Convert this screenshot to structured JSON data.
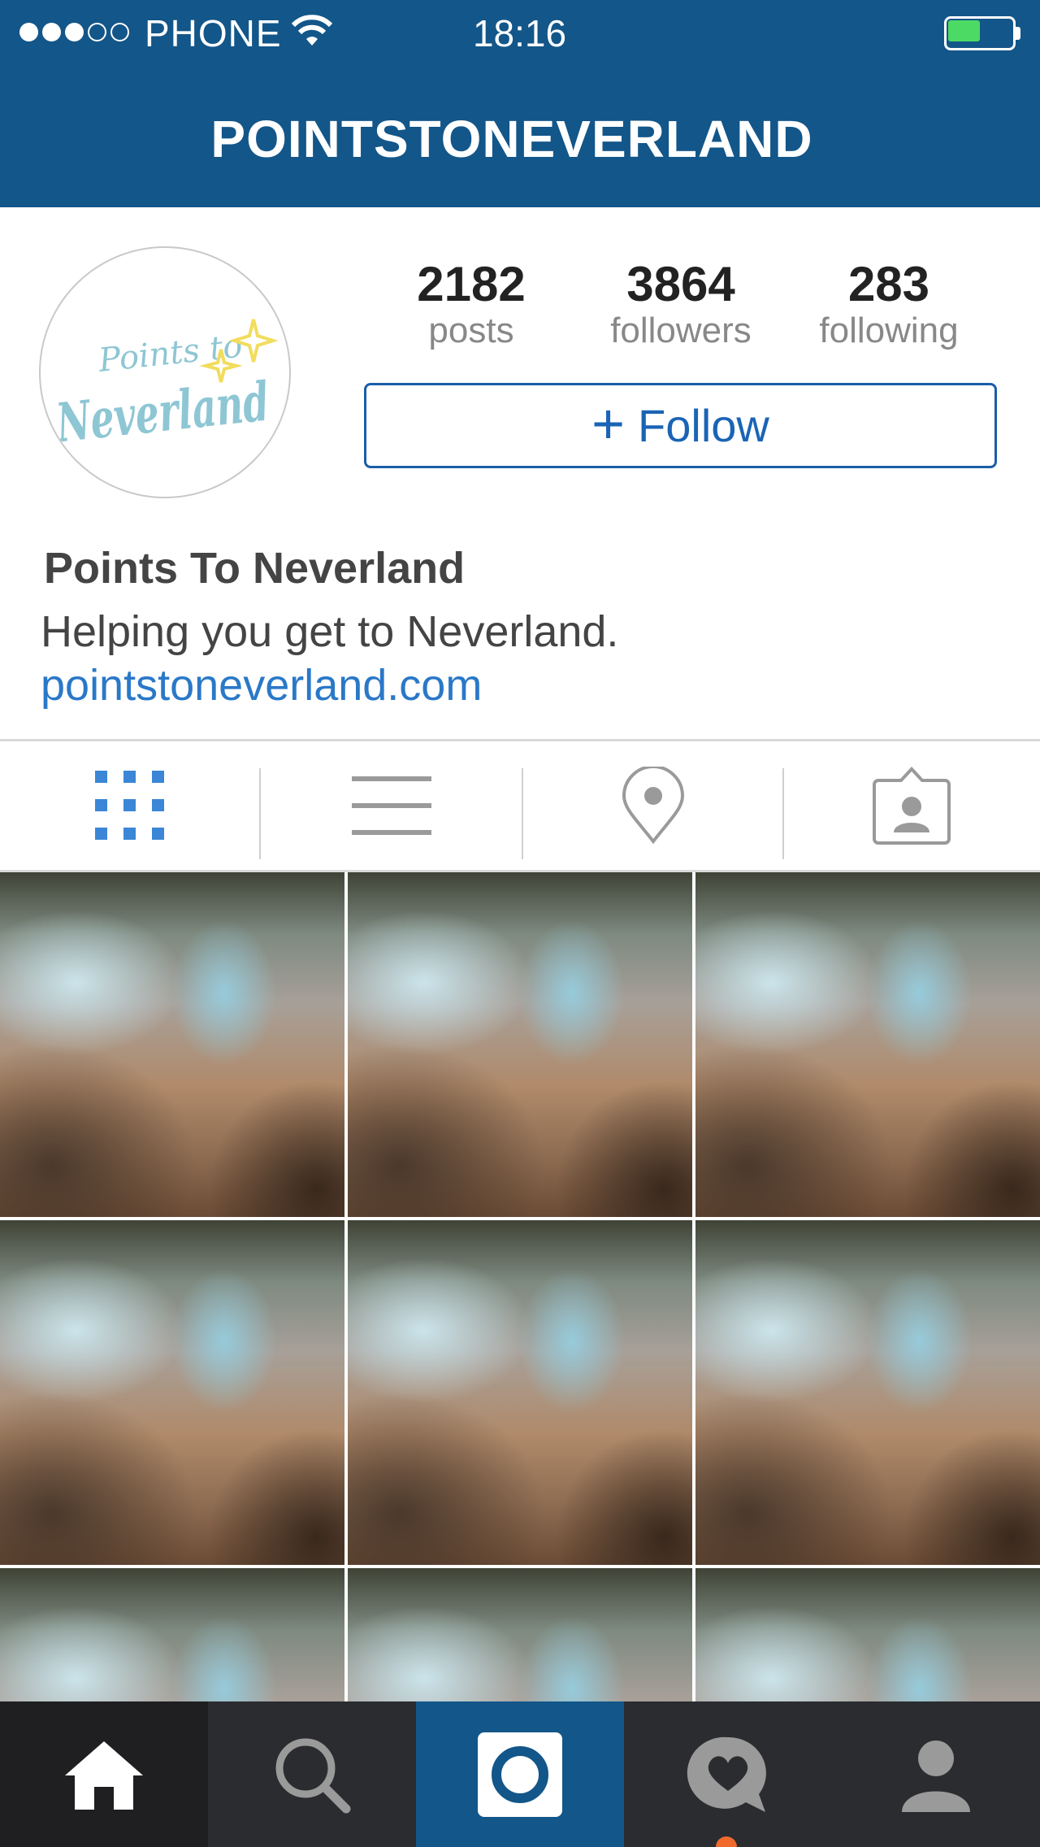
{
  "status_bar": {
    "carrier": "PHONE",
    "time": "18:16",
    "signal_bars_filled": 3,
    "signal_bars_total": 5,
    "battery_level": 0.5,
    "battery_color": "#4cd964"
  },
  "header": {
    "title": "POINTSTONEVERLAND",
    "background": "#135689"
  },
  "profile": {
    "avatar_logo_text_top": "Points to",
    "avatar_logo_text_main": "Neverland",
    "stats": [
      {
        "value": "2182",
        "label": "posts"
      },
      {
        "value": "3864",
        "label": "followers"
      },
      {
        "value": "283",
        "label": "following"
      }
    ],
    "follow_button": {
      "icon": "+",
      "label": "Follow"
    },
    "name": "Points To Neverland",
    "bio": "Helping you get to Neverland.",
    "website": "pointstoneverland.com"
  },
  "tabs": [
    {
      "icon": "grid-icon",
      "active": true
    },
    {
      "icon": "list-icon",
      "active": false
    },
    {
      "icon": "location-pin-icon",
      "active": false
    },
    {
      "icon": "tagged-person-icon",
      "active": false
    }
  ],
  "bottom_nav": [
    {
      "icon": "home-icon",
      "active": true
    },
    {
      "icon": "search-icon",
      "active": false
    },
    {
      "icon": "camera-icon",
      "active": false
    },
    {
      "icon": "activity-heart-icon",
      "active": false,
      "has_notification": true
    },
    {
      "icon": "profile-icon",
      "active": false
    }
  ],
  "colors": {
    "accent_blue": "#1a64b5",
    "link_blue": "#2a78c8",
    "nav_dark": "#2b2c30",
    "notification": "#f06a2d"
  }
}
